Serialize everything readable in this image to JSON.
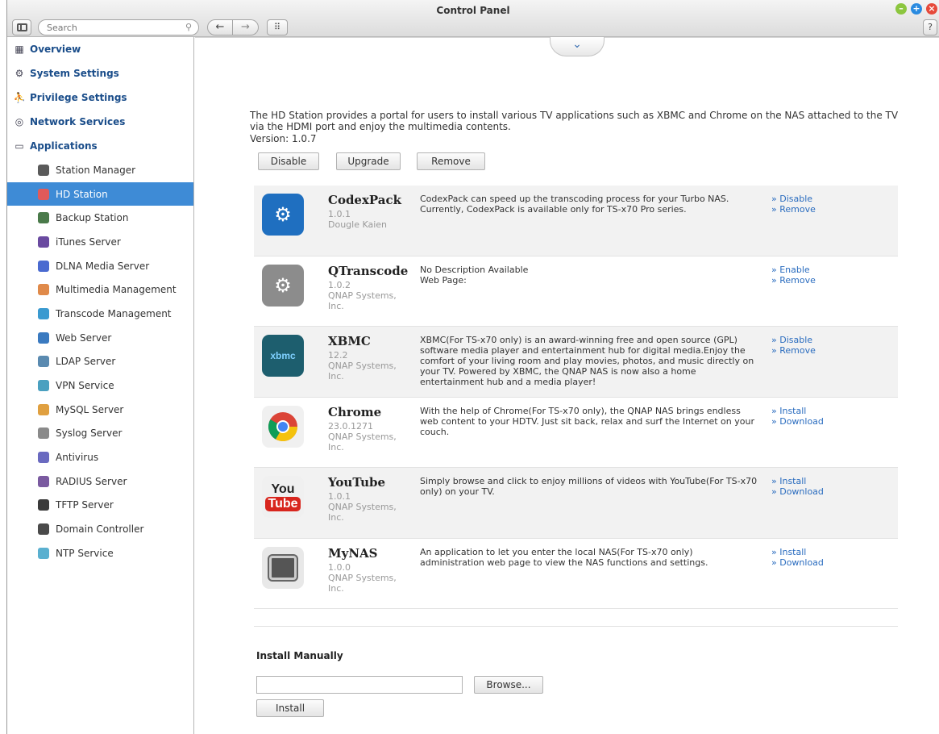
{
  "window": {
    "title": "Control Panel"
  },
  "toolbar": {
    "search_placeholder": "Search",
    "back": "←",
    "forward": "→",
    "apps": "⠿",
    "help": "?"
  },
  "sidebar": {
    "top_items": [
      {
        "label": "Overview",
        "icon": "overview-icon"
      },
      {
        "label": "System Settings",
        "icon": "gear-icon"
      },
      {
        "label": "Privilege Settings",
        "icon": "user-icon"
      },
      {
        "label": "Network Services",
        "icon": "network-icon"
      },
      {
        "label": "Applications",
        "icon": "folder-icon"
      }
    ],
    "app_items": [
      {
        "label": "Station Manager",
        "color": "#5a5a5a"
      },
      {
        "label": "HD Station",
        "color": "#e05a5a",
        "active": true
      },
      {
        "label": "Backup Station",
        "color": "#4a7a4a"
      },
      {
        "label": "iTunes Server",
        "color": "#6a4aa0"
      },
      {
        "label": "DLNA Media Server",
        "color": "#4a6ad0"
      },
      {
        "label": "Multimedia Management",
        "color": "#e08a4a"
      },
      {
        "label": "Transcode Management",
        "color": "#3a9ad0"
      },
      {
        "label": "Web Server",
        "color": "#3a7ac0"
      },
      {
        "label": "LDAP Server",
        "color": "#5a8ab0"
      },
      {
        "label": "VPN Service",
        "color": "#4aa0c0"
      },
      {
        "label": "MySQL Server",
        "color": "#e0a040"
      },
      {
        "label": "Syslog Server",
        "color": "#8a8a8a"
      },
      {
        "label": "Antivirus",
        "color": "#6a6ac0"
      },
      {
        "label": "RADIUS Server",
        "color": "#7a5aa0"
      },
      {
        "label": "TFTP Server",
        "color": "#3a3a3a"
      },
      {
        "label": "Domain Controller",
        "color": "#4a4a4a"
      },
      {
        "label": "NTP Service",
        "color": "#5ab0d0"
      }
    ]
  },
  "main": {
    "description": "The HD Station provides a portal for users to install various TV applications such as XBMC and Chrome on the NAS attached to the TV via the HDMI port and enjoy the multimedia contents.",
    "version": "Version: 1.0.7",
    "buttons": {
      "disable": "Disable",
      "upgrade": "Upgrade",
      "remove": "Remove"
    },
    "apps": [
      {
        "name": "CodexPack",
        "version": "1.0.1",
        "vendor": "Dougle Kaien",
        "desc": "CodexPack can speed up the transcoding process for your Turbo NAS. Currently, CodexPack is available only for TS-x70 Pro series.",
        "actions": [
          "» Disable",
          "» Remove"
        ],
        "icon_label": "⚙",
        "icon_color": "#1f6fc0"
      },
      {
        "name": "QTranscode",
        "version": "1.0.2",
        "vendor": "QNAP Systems, Inc.",
        "desc": "No Description Available\nWeb Page:",
        "actions": [
          "» Enable",
          "» Remove"
        ],
        "icon_label": "⚙",
        "icon_color": "#8c8c8c"
      },
      {
        "name": "XBMC",
        "version": "12.2",
        "vendor": "QNAP Systems, Inc.",
        "desc": "XBMC(For TS-x70 only) is an award-winning free and open source (GPL) software media player and entertainment hub for digital media.Enjoy the comfort of your living room and play movies, photos, and music directly on your TV. Powered by XBMC, the QNAP NAS is now also a home entertainment hub and a media player!",
        "actions": [
          "» Disable",
          "» Remove"
        ],
        "icon_label": "xbmc",
        "icon_color": "#1d5e6e"
      },
      {
        "name": "Chrome",
        "version": "23.0.1271",
        "vendor": "QNAP Systems, Inc.",
        "desc": "With the help of Chrome(For TS-x70 only), the QNAP NAS brings endless web content to your HDTV. Just sit back, relax and surf the Internet on your couch.",
        "actions": [
          "» Install",
          "» Download"
        ],
        "icon_label": "",
        "icon_color": "#f0f0f0"
      },
      {
        "name": "YouTube",
        "version": "1.0.1",
        "vendor": "QNAP Systems, Inc.",
        "desc": "Simply browse and click to enjoy millions of videos with YouTube(For TS-x70 only) on your TV.",
        "actions": [
          "» Install",
          "» Download"
        ],
        "icon_label": "You Tube",
        "icon_color": "#f0f0f0"
      },
      {
        "name": "MyNAS",
        "version": "1.0.0",
        "vendor": "QNAP Systems, Inc.",
        "desc": "An application to let you enter the local NAS(For TS-x70 only) administration web page to view the NAS functions and settings.",
        "actions": [
          "» Install",
          "» Download"
        ],
        "icon_label": "",
        "icon_color": "#e8e8e8"
      }
    ],
    "install": {
      "title": "Install Manually",
      "browse": "Browse...",
      "install": "Install"
    }
  }
}
